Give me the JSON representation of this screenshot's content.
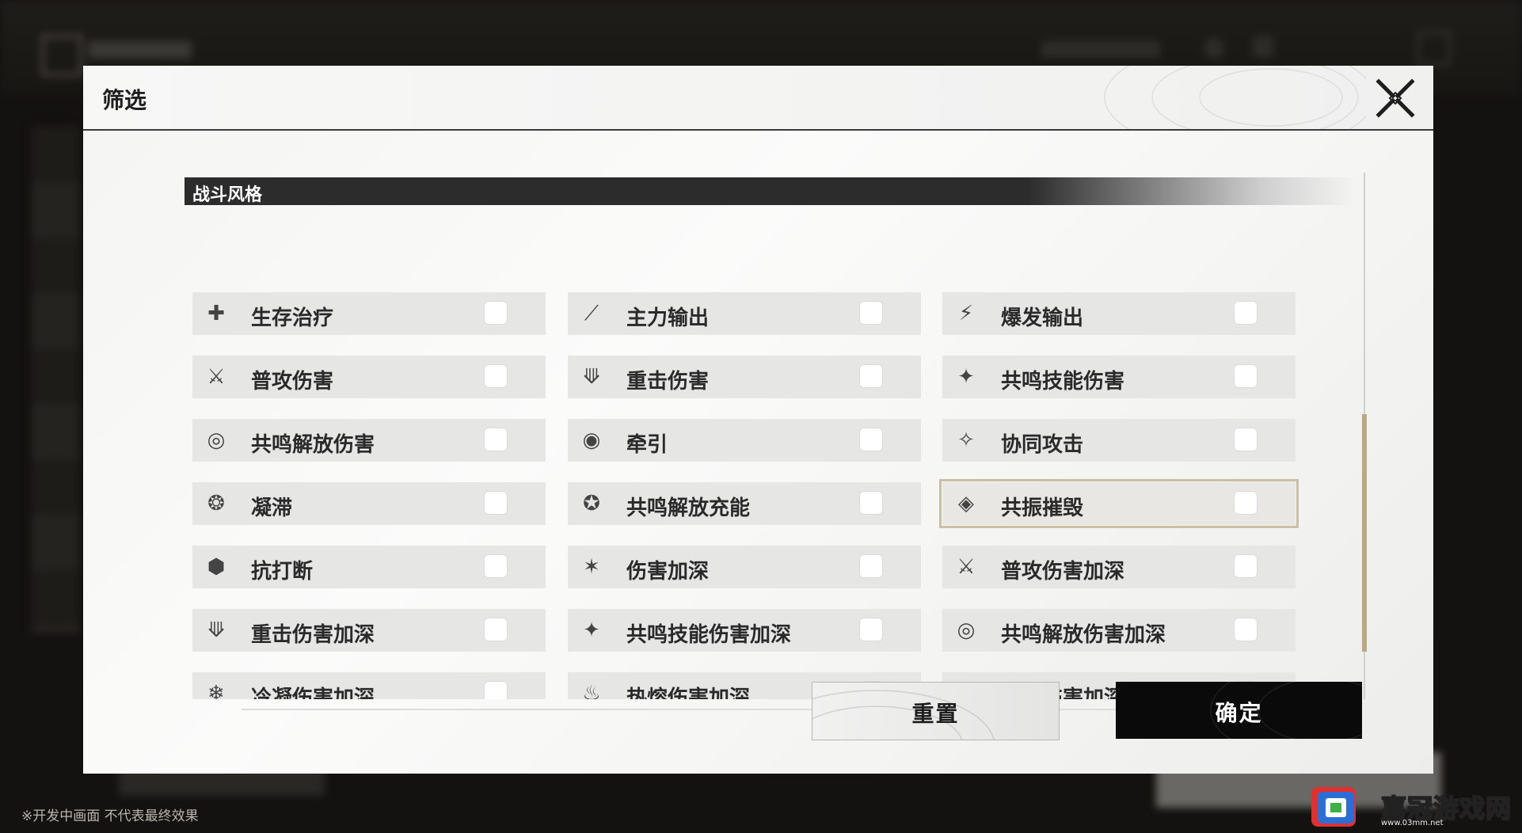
{
  "modal": {
    "title": "筛选",
    "close_icon": "close-x-icon"
  },
  "section": {
    "title": "战斗风格"
  },
  "filters": [
    {
      "label": "生存治疗",
      "icon": "healing-icon",
      "glyph": "✚",
      "checked": false,
      "selected": false
    },
    {
      "label": "主力输出",
      "icon": "main-dps-icon",
      "glyph": "⟋",
      "checked": false,
      "selected": false
    },
    {
      "label": "爆发输出",
      "icon": "burst-dps-icon",
      "glyph": "⚡",
      "checked": false,
      "selected": false
    },
    {
      "label": "普攻伤害",
      "icon": "basic-attack-icon",
      "glyph": "⚔",
      "checked": false,
      "selected": false
    },
    {
      "label": "重击伤害",
      "icon": "heavy-attack-icon",
      "glyph": "⟱",
      "checked": false,
      "selected": false
    },
    {
      "label": "共鸣技能伤害",
      "icon": "resonance-skill-icon",
      "glyph": "✦",
      "checked": false,
      "selected": false
    },
    {
      "label": "共鸣解放伤害",
      "icon": "resonance-liberation-icon",
      "glyph": "◎",
      "checked": false,
      "selected": false
    },
    {
      "label": "牵引",
      "icon": "pull-icon",
      "glyph": "◉",
      "checked": false,
      "selected": false
    },
    {
      "label": "协同攻击",
      "icon": "coordinated-attack-icon",
      "glyph": "✧",
      "checked": false,
      "selected": false
    },
    {
      "label": "凝滞",
      "icon": "stagnate-icon",
      "glyph": "❂",
      "checked": false,
      "selected": false
    },
    {
      "label": "共鸣解放充能",
      "icon": "liberation-energy-icon",
      "glyph": "✪",
      "checked": false,
      "selected": false
    },
    {
      "label": "共振摧毁",
      "icon": "resonance-destroy-icon",
      "glyph": "◈",
      "checked": false,
      "selected": true
    },
    {
      "label": "抗打断",
      "icon": "anti-interrupt-icon",
      "glyph": "⬢",
      "checked": false,
      "selected": false
    },
    {
      "label": "伤害加深",
      "icon": "damage-amplify-icon",
      "glyph": "✶",
      "checked": false,
      "selected": false
    },
    {
      "label": "普攻伤害加深",
      "icon": "basic-attack-amplify-icon",
      "glyph": "⚔",
      "checked": false,
      "selected": false
    },
    {
      "label": "重击伤害加深",
      "icon": "heavy-attack-amplify-icon",
      "glyph": "⟱",
      "checked": false,
      "selected": false
    },
    {
      "label": "共鸣技能伤害加深",
      "icon": "resonance-skill-amplify-icon",
      "glyph": "✦",
      "checked": false,
      "selected": false
    },
    {
      "label": "共鸣解放伤害加深",
      "icon": "liberation-amplify-icon",
      "glyph": "◎",
      "checked": false,
      "selected": false
    },
    {
      "label": "冷凝伤害加深",
      "icon": "glacio-amplify-icon",
      "glyph": "❄",
      "checked": false,
      "selected": false
    },
    {
      "label": "热熔伤害加深",
      "icon": "fusion-amplify-icon",
      "glyph": "♨",
      "checked": false,
      "selected": false
    },
    {
      "label": "导电伤害加深",
      "icon": "electro-amplify-icon",
      "glyph": "ϟ",
      "checked": false,
      "selected": false
    }
  ],
  "buttons": {
    "reset": "重置",
    "confirm": "确定"
  },
  "footer": {
    "dev_note": "※开发中画面 不代表最终效果"
  },
  "watermark": {
    "text": "嘉冠游戏网",
    "url": "www.03mm.net"
  },
  "colors": {
    "accent_gold": "#b8ab82",
    "section_bar": "#2c2c2c",
    "confirm_bg": "#0a0a0a"
  }
}
